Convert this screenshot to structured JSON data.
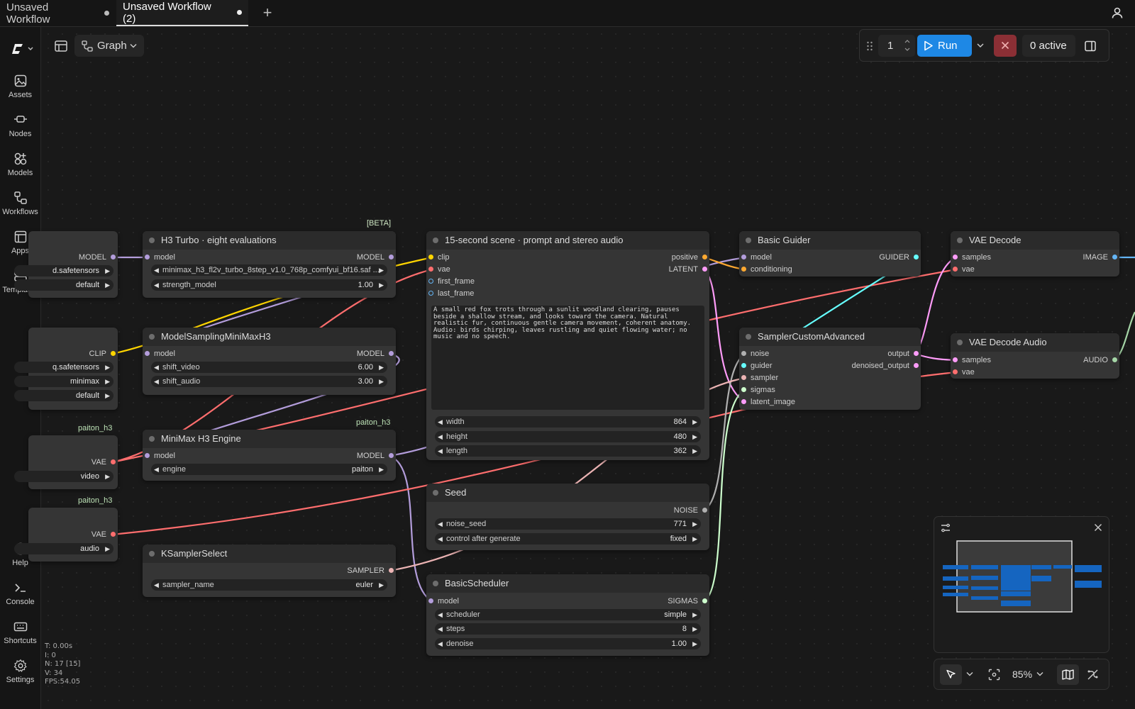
{
  "tabs": [
    {
      "label": "Unsaved Workflow"
    },
    {
      "label": "Unsaved Workflow (2)"
    }
  ],
  "sidebar": {
    "items": [
      {
        "label": "Assets",
        "icon": "assets-icon"
      },
      {
        "label": "Nodes",
        "icon": "nodes-icon"
      },
      {
        "label": "Models",
        "icon": "models-icon"
      },
      {
        "label": "Workflows",
        "icon": "workflows-icon"
      },
      {
        "label": "Apps",
        "icon": "apps-icon"
      },
      {
        "label": "Templates",
        "icon": "templates-icon"
      },
      {
        "label": "Help",
        "icon": "help-icon"
      },
      {
        "label": "Console",
        "icon": "console-icon"
      },
      {
        "label": "Shortcuts",
        "icon": "keyboard-icon"
      },
      {
        "label": "Settings",
        "icon": "gear-icon"
      }
    ]
  },
  "toolbar": {
    "view_mode": "Graph",
    "batch_count": "1",
    "run_label": "Run",
    "queue_status": "0 active"
  },
  "zoom": {
    "level": "85%"
  },
  "stats": {
    "time": "T: 0.00s",
    "iter": "I: 0",
    "nodes": "N: 17 [15]",
    "vertices": "V: 34",
    "fps": "FPS:54.05"
  },
  "badges": {
    "beta": "[BETA]",
    "paiton1": "paiton_h3",
    "paiton2": "paiton_h3",
    "paiton3": "paiton_h3"
  },
  "nodes": {
    "left_model": {
      "out": "MODEL",
      "w1": "d.safetensors",
      "w2": "default"
    },
    "left_clip": {
      "out": "CLIP",
      "w1": "q.safetensors",
      "w2": "minimax",
      "w3": "default"
    },
    "left_vae_video": {
      "out": "VAE",
      "w1": "video"
    },
    "left_vae_audio": {
      "out": "VAE",
      "w1": "audio"
    },
    "h3turbo": {
      "title": "H3 Turbo · eight evaluations",
      "in_model": "model",
      "out_model": "MODEL",
      "w_lora": "minimax_h3_fl2v_turbo_8step_v1.0_768p_comfyui_bf16.saf ...",
      "w_strength_label": "strength_model",
      "w_strength": "1.00"
    },
    "msampling": {
      "title": "ModelSamplingMiniMaxH3",
      "in_model": "model",
      "out_model": "MODEL",
      "w1_label": "shift_video",
      "w1": "6.00",
      "w2_label": "shift_audio",
      "w2": "3.00"
    },
    "engine": {
      "title": "MiniMax H3 Engine",
      "in_model": "model",
      "out_model": "MODEL",
      "w_label": "engine",
      "w": "paiton"
    },
    "ksampler": {
      "title": "KSamplerSelect",
      "out": "SAMPLER",
      "w_label": "sampler_name",
      "w": "euler"
    },
    "scene": {
      "title": "15-second scene · prompt and stereo audio",
      "in_clip": "clip",
      "in_vae": "vae",
      "in_first": "first_frame",
      "in_last": "last_frame",
      "out_pos": "positive",
      "out_latent": "LATENT",
      "prompt": "A small red fox trots through a sunlit woodland clearing, pauses beside a shallow stream, and looks toward the camera. Natural realistic fur, continuous gentle camera movement, coherent anatomy. Audio: birds chirping, leaves rustling and quiet flowing water; no music and no speech.",
      "w_width_label": "width",
      "w_width": "864",
      "w_height_label": "height",
      "w_height": "480",
      "w_length_label": "length",
      "w_length": "362"
    },
    "seed": {
      "title": "Seed",
      "out": "NOISE",
      "w1_label": "noise_seed",
      "w1": "771",
      "w2_label": "control after generate",
      "w2": "fixed"
    },
    "scheduler": {
      "title": "BasicScheduler",
      "in_model": "model",
      "out": "SIGMAS",
      "w1_label": "scheduler",
      "w1": "simple",
      "w2_label": "steps",
      "w2": "8",
      "w3_label": "denoise",
      "w3": "1.00"
    },
    "guider": {
      "title": "Basic Guider",
      "in_model": "model",
      "in_cond": "conditioning",
      "out": "GUIDER"
    },
    "sca": {
      "title": "SamplerCustomAdvanced",
      "in_noise": "noise",
      "in_guider": "guider",
      "in_sampler": "sampler",
      "in_sigmas": "sigmas",
      "in_latent": "latent_image",
      "out_output": "output",
      "out_denoised": "denoised_output"
    },
    "vaedecode": {
      "title": "VAE Decode",
      "in_samples": "samples",
      "in_vae": "vae",
      "out": "IMAGE"
    },
    "vaedecodeaudio": {
      "title": "VAE Decode Audio",
      "in_samples": "samples",
      "in_vae": "vae",
      "out": "AUDIO"
    }
  },
  "colors": {
    "model": "#b39ddb",
    "clip": "#ffd500",
    "vae": "#ff6e6e",
    "latent": "#ff9cf9",
    "conditioning": "#ffa931",
    "noise": "#b0b0b0",
    "guider": "#66ffff",
    "sampler": "#ecb4b4",
    "sigmas": "#cdffcd",
    "image": "#64b5f6",
    "audio": "#a5d6a7",
    "accent": "#1e88e5"
  }
}
